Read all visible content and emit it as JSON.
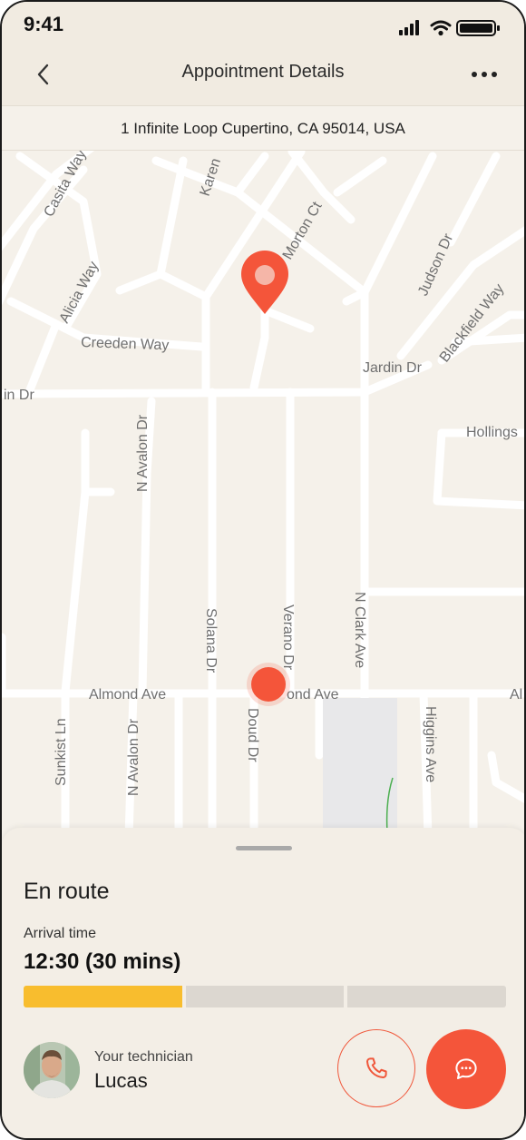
{
  "status_bar": {
    "time": "9:41",
    "icons": [
      "signal-icon",
      "wifi-icon",
      "battery-icon"
    ]
  },
  "nav": {
    "title": "Appointment Details",
    "back_icon": "chevron-left-icon",
    "more_icon": "more-horizontal-icon"
  },
  "address": "1 Infinite Loop Cupertino, CA 95014, USA",
  "map": {
    "streets": [
      "Casita Way",
      "Karen",
      "Morton Ct",
      "Alicia Way",
      "Creeden Way",
      "Judson Dr",
      "Blackfield Way",
      "Jardin Dr",
      "in Dr",
      "N Avalon Dr",
      "Hollings",
      "Solana Dr",
      "Verano Dr",
      "N Clark Ave",
      "Almond Ave",
      "ond Ave",
      "Al",
      "Sunkist Ln",
      "N Avalon Dr",
      "Doud Dr",
      "Higgins Ave"
    ],
    "destination_pin_icon": "location-pin-icon",
    "technician_marker_icon": "technician-location-dot"
  },
  "sheet": {
    "status": "En route",
    "arrival_label": "Arrival time",
    "arrival_value": "12:30 (30 mins)",
    "progress": {
      "segments": 3,
      "completed": 1
    },
    "technician_label": "Your technician",
    "technician_name": "Lucas",
    "call_icon": "phone-icon",
    "chat_icon": "chat-bubble-icon"
  },
  "colors": {
    "accent": "#f4553a",
    "progress_fill": "#f8bd2e",
    "progress_track": "#dcd7d0",
    "background": "#f5f1ea",
    "map_road": "#ffffff"
  }
}
